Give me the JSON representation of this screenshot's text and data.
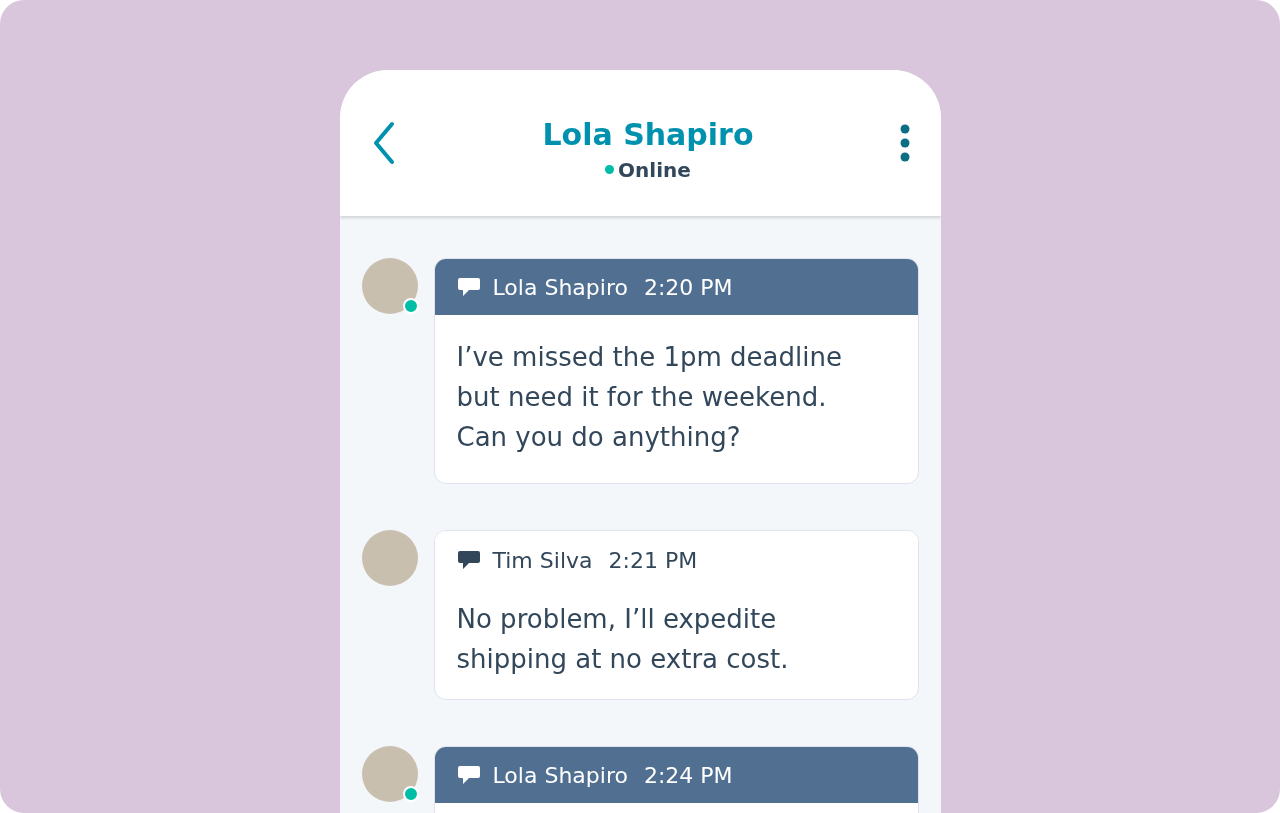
{
  "header": {
    "title": "Lola Shapiro",
    "status": "Online",
    "online": true
  },
  "messages": [
    {
      "kind": "incoming",
      "sender": "Lola Shapiro",
      "time": "2:20 PM",
      "online": true,
      "text": "I’ve missed the 1pm deadline but need it for the weekend. Can you do anything?"
    },
    {
      "kind": "outgoing",
      "sender": "Tim Silva",
      "time": "2:21 PM",
      "online": false,
      "text": "No problem, I’ll expedite shipping at no extra cost."
    },
    {
      "kind": "incoming",
      "sender": "Lola Shapiro",
      "time": "2:24 PM",
      "online": true
    }
  ]
}
